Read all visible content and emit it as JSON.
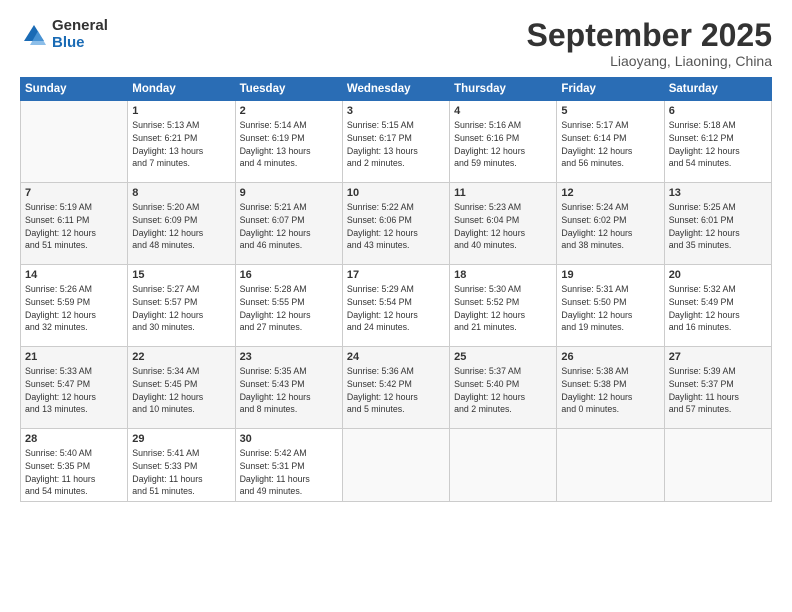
{
  "logo": {
    "general": "General",
    "blue": "Blue"
  },
  "title": "September 2025",
  "subtitle": "Liaoyang, Liaoning, China",
  "days_header": [
    "Sunday",
    "Monday",
    "Tuesday",
    "Wednesday",
    "Thursday",
    "Friday",
    "Saturday"
  ],
  "weeks": [
    [
      {
        "day": "",
        "info": ""
      },
      {
        "day": "1",
        "info": "Sunrise: 5:13 AM\nSunset: 6:21 PM\nDaylight: 13 hours\nand 7 minutes."
      },
      {
        "day": "2",
        "info": "Sunrise: 5:14 AM\nSunset: 6:19 PM\nDaylight: 13 hours\nand 4 minutes."
      },
      {
        "day": "3",
        "info": "Sunrise: 5:15 AM\nSunset: 6:17 PM\nDaylight: 13 hours\nand 2 minutes."
      },
      {
        "day": "4",
        "info": "Sunrise: 5:16 AM\nSunset: 6:16 PM\nDaylight: 12 hours\nand 59 minutes."
      },
      {
        "day": "5",
        "info": "Sunrise: 5:17 AM\nSunset: 6:14 PM\nDaylight: 12 hours\nand 56 minutes."
      },
      {
        "day": "6",
        "info": "Sunrise: 5:18 AM\nSunset: 6:12 PM\nDaylight: 12 hours\nand 54 minutes."
      }
    ],
    [
      {
        "day": "7",
        "info": "Sunrise: 5:19 AM\nSunset: 6:11 PM\nDaylight: 12 hours\nand 51 minutes."
      },
      {
        "day": "8",
        "info": "Sunrise: 5:20 AM\nSunset: 6:09 PM\nDaylight: 12 hours\nand 48 minutes."
      },
      {
        "day": "9",
        "info": "Sunrise: 5:21 AM\nSunset: 6:07 PM\nDaylight: 12 hours\nand 46 minutes."
      },
      {
        "day": "10",
        "info": "Sunrise: 5:22 AM\nSunset: 6:06 PM\nDaylight: 12 hours\nand 43 minutes."
      },
      {
        "day": "11",
        "info": "Sunrise: 5:23 AM\nSunset: 6:04 PM\nDaylight: 12 hours\nand 40 minutes."
      },
      {
        "day": "12",
        "info": "Sunrise: 5:24 AM\nSunset: 6:02 PM\nDaylight: 12 hours\nand 38 minutes."
      },
      {
        "day": "13",
        "info": "Sunrise: 5:25 AM\nSunset: 6:01 PM\nDaylight: 12 hours\nand 35 minutes."
      }
    ],
    [
      {
        "day": "14",
        "info": "Sunrise: 5:26 AM\nSunset: 5:59 PM\nDaylight: 12 hours\nand 32 minutes."
      },
      {
        "day": "15",
        "info": "Sunrise: 5:27 AM\nSunset: 5:57 PM\nDaylight: 12 hours\nand 30 minutes."
      },
      {
        "day": "16",
        "info": "Sunrise: 5:28 AM\nSunset: 5:55 PM\nDaylight: 12 hours\nand 27 minutes."
      },
      {
        "day": "17",
        "info": "Sunrise: 5:29 AM\nSunset: 5:54 PM\nDaylight: 12 hours\nand 24 minutes."
      },
      {
        "day": "18",
        "info": "Sunrise: 5:30 AM\nSunset: 5:52 PM\nDaylight: 12 hours\nand 21 minutes."
      },
      {
        "day": "19",
        "info": "Sunrise: 5:31 AM\nSunset: 5:50 PM\nDaylight: 12 hours\nand 19 minutes."
      },
      {
        "day": "20",
        "info": "Sunrise: 5:32 AM\nSunset: 5:49 PM\nDaylight: 12 hours\nand 16 minutes."
      }
    ],
    [
      {
        "day": "21",
        "info": "Sunrise: 5:33 AM\nSunset: 5:47 PM\nDaylight: 12 hours\nand 13 minutes."
      },
      {
        "day": "22",
        "info": "Sunrise: 5:34 AM\nSunset: 5:45 PM\nDaylight: 12 hours\nand 10 minutes."
      },
      {
        "day": "23",
        "info": "Sunrise: 5:35 AM\nSunset: 5:43 PM\nDaylight: 12 hours\nand 8 minutes."
      },
      {
        "day": "24",
        "info": "Sunrise: 5:36 AM\nSunset: 5:42 PM\nDaylight: 12 hours\nand 5 minutes."
      },
      {
        "day": "25",
        "info": "Sunrise: 5:37 AM\nSunset: 5:40 PM\nDaylight: 12 hours\nand 2 minutes."
      },
      {
        "day": "26",
        "info": "Sunrise: 5:38 AM\nSunset: 5:38 PM\nDaylight: 12 hours\nand 0 minutes."
      },
      {
        "day": "27",
        "info": "Sunrise: 5:39 AM\nSunset: 5:37 PM\nDaylight: 11 hours\nand 57 minutes."
      }
    ],
    [
      {
        "day": "28",
        "info": "Sunrise: 5:40 AM\nSunset: 5:35 PM\nDaylight: 11 hours\nand 54 minutes."
      },
      {
        "day": "29",
        "info": "Sunrise: 5:41 AM\nSunset: 5:33 PM\nDaylight: 11 hours\nand 51 minutes."
      },
      {
        "day": "30",
        "info": "Sunrise: 5:42 AM\nSunset: 5:31 PM\nDaylight: 11 hours\nand 49 minutes."
      },
      {
        "day": "",
        "info": ""
      },
      {
        "day": "",
        "info": ""
      },
      {
        "day": "",
        "info": ""
      },
      {
        "day": "",
        "info": ""
      }
    ]
  ]
}
